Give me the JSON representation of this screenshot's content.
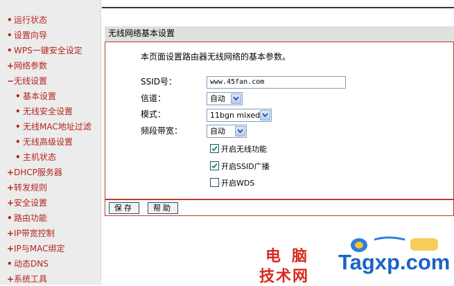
{
  "sidebar": {
    "items": [
      {
        "mark": "•",
        "label": "运行状态",
        "sub": false
      },
      {
        "mark": "•",
        "label": "设置向导",
        "sub": false
      },
      {
        "mark": "•",
        "label": "WPS一键安全设定",
        "sub": false
      },
      {
        "mark": "+",
        "label": "网络参数",
        "sub": false
      },
      {
        "mark": "−",
        "label": "无线设置",
        "sub": false
      },
      {
        "mark": "•",
        "label": "基本设置",
        "sub": true
      },
      {
        "mark": "•",
        "label": "无线安全设置",
        "sub": true
      },
      {
        "mark": "•",
        "label": "无线MAC地址过滤",
        "sub": true
      },
      {
        "mark": "•",
        "label": "无线高级设置",
        "sub": true
      },
      {
        "mark": "•",
        "label": "主机状态",
        "sub": true
      },
      {
        "mark": "+",
        "label": "DHCP服务器",
        "sub": false
      },
      {
        "mark": "+",
        "label": "转发规则",
        "sub": false
      },
      {
        "mark": "+",
        "label": "安全设置",
        "sub": false
      },
      {
        "mark": "•",
        "label": "路由功能",
        "sub": false
      },
      {
        "mark": "+",
        "label": "IP带宽控制",
        "sub": false
      },
      {
        "mark": "+",
        "label": "IP与MAC绑定",
        "sub": false
      },
      {
        "mark": "•",
        "label": "动态DNS",
        "sub": false
      },
      {
        "mark": "+",
        "label": "系统工具",
        "sub": false
      }
    ]
  },
  "panel": {
    "title": "无线网络基本设置",
    "intro": "本页面设置路由器无线网络的基本参数。",
    "ssid_label": "SSID号：",
    "ssid_value": "www.45fan.com",
    "channel_label": "信道：",
    "channel_value": "自动",
    "mode_label": "模式：",
    "mode_value": "11bgn mixed",
    "bandwidth_label": "频段带宽：",
    "bandwidth_value": "自动",
    "checks": [
      {
        "label": "开启无线功能",
        "checked": true
      },
      {
        "label": "开启SSID广播",
        "checked": true
      },
      {
        "label": "开启WDS",
        "checked": false
      }
    ]
  },
  "buttons": {
    "save": "保存",
    "help": "帮助"
  },
  "watermark": {
    "line1": "电脑",
    "line2": "技术网",
    "site": "Tagxp.com"
  },
  "colors": {
    "menu_text": "#b3261e",
    "panel_border": "#c0392b",
    "watermark_red": "#d6291c",
    "watermark_blue": "#1b63c6"
  }
}
